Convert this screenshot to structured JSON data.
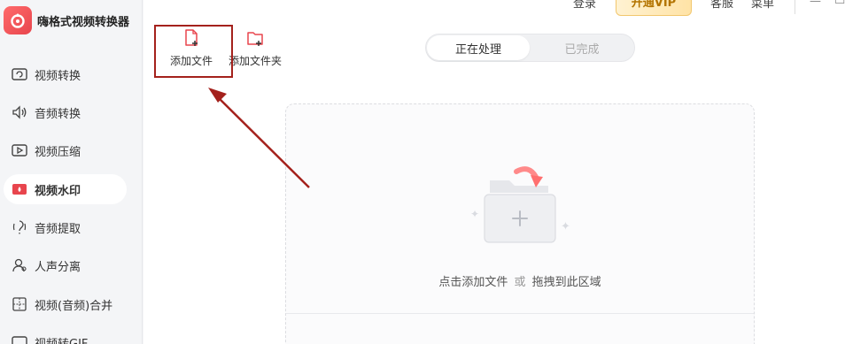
{
  "app": {
    "title": "嗨格式视频转换器"
  },
  "sidebar": {
    "items": [
      {
        "label": "视频转换"
      },
      {
        "label": "音频转换"
      },
      {
        "label": "视频压缩"
      },
      {
        "label": "视频水印"
      },
      {
        "label": "音频提取"
      },
      {
        "label": "人声分离"
      },
      {
        "label": "视频(音频)合并"
      },
      {
        "label": "视频转GIF"
      }
    ],
    "active_index": 3
  },
  "topbar": {
    "login": "登录",
    "vip": "开通VIP",
    "service": "客服",
    "menu": "菜单"
  },
  "toolbar": {
    "add_file": "添加文件",
    "add_folder": "添加文件夹"
  },
  "tabs": {
    "processing": "正在处理",
    "done": "已完成"
  },
  "dropzone": {
    "hint_click": "点击添加文件",
    "hint_or": "或",
    "hint_drag": "拖拽到此区域"
  },
  "colors": {
    "accent": "#e8454d",
    "highlight": "#a4211c",
    "vip_text": "#b37400"
  }
}
